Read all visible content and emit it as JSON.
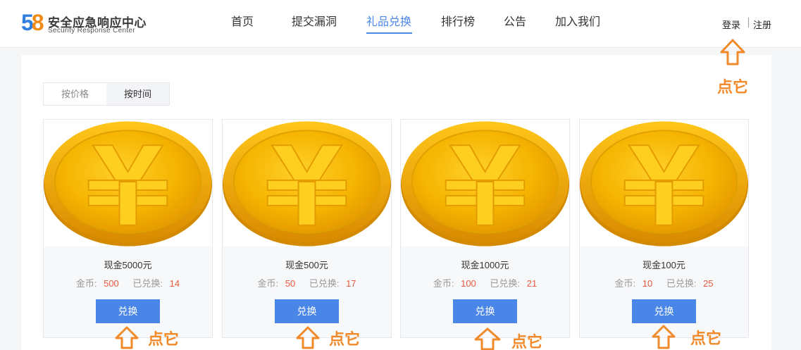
{
  "logo": {
    "digit1": "5",
    "digit2": "8",
    "title": "安全应急响应中心",
    "subtitle": "Security Response Center"
  },
  "nav": [
    {
      "label": "首页"
    },
    {
      "label": "提交漏洞"
    },
    {
      "label": "礼品兑换",
      "active": true
    },
    {
      "label": "排行榜"
    },
    {
      "label": "公告"
    },
    {
      "label": "加入我们"
    }
  ],
  "auth": {
    "login": "登录",
    "register": "注册"
  },
  "sort": {
    "by_price": "按价格",
    "by_time": "按时间",
    "selected": "by_time"
  },
  "products": [
    {
      "title": "现金5000元",
      "coin_label": "金币:",
      "coins": "500",
      "redeemed_label": "已兑换:",
      "redeemed": "14",
      "button": "兑换"
    },
    {
      "title": "现金500元",
      "coin_label": "金币:",
      "coins": "50",
      "redeemed_label": "已兑换:",
      "redeemed": "17",
      "button": "兑换"
    },
    {
      "title": "现金1000元",
      "coin_label": "金币:",
      "coins": "100",
      "redeemed_label": "已兑换:",
      "redeemed": "21",
      "button": "兑换"
    },
    {
      "title": "现金100元",
      "coin_label": "金币:",
      "coins": "10",
      "redeemed_label": "已兑换:",
      "redeemed": "25",
      "button": "兑换"
    }
  ],
  "annotations": {
    "click_hint": "点它",
    "arrow_color": "#f08a2a"
  },
  "colors": {
    "accent": "#4a86e8",
    "value": "#e85a3c",
    "coin_gold": "#f5b800"
  }
}
